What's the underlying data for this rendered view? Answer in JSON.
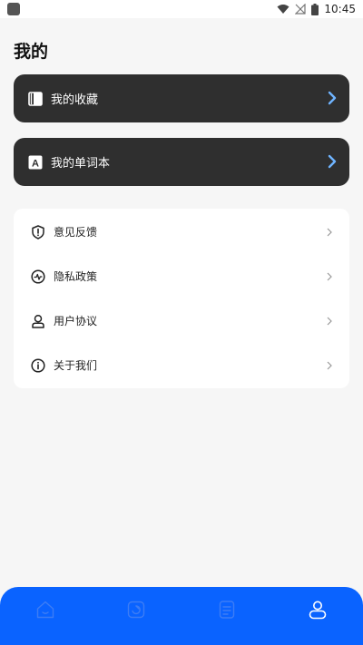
{
  "status_bar": {
    "time": "10:45",
    "icons": [
      "wifi-icon",
      "no-signal-icon",
      "battery-icon"
    ]
  },
  "page": {
    "title": "我的"
  },
  "cards": [
    {
      "label": "我的收藏",
      "icon": "book-icon"
    },
    {
      "label": "我的单词本",
      "icon": "letter-a-icon"
    }
  ],
  "menu": [
    {
      "label": "意见反馈",
      "icon": "feedback-shield-icon"
    },
    {
      "label": "隐私政策",
      "icon": "activity-icon"
    },
    {
      "label": "用户协议",
      "icon": "user-icon"
    },
    {
      "label": "关于我们",
      "icon": "info-icon"
    }
  ],
  "tabs": [
    {
      "icon": "home-icon",
      "active": false
    },
    {
      "icon": "practice-icon",
      "active": false
    },
    {
      "icon": "notes-icon",
      "active": false
    },
    {
      "icon": "profile-icon",
      "active": true
    }
  ],
  "colors": {
    "background": "#f6f6f6",
    "card_dark": "#2f2f2f",
    "chevron_accent": "#6fb4ff",
    "tabbar": "#0a63ff"
  }
}
